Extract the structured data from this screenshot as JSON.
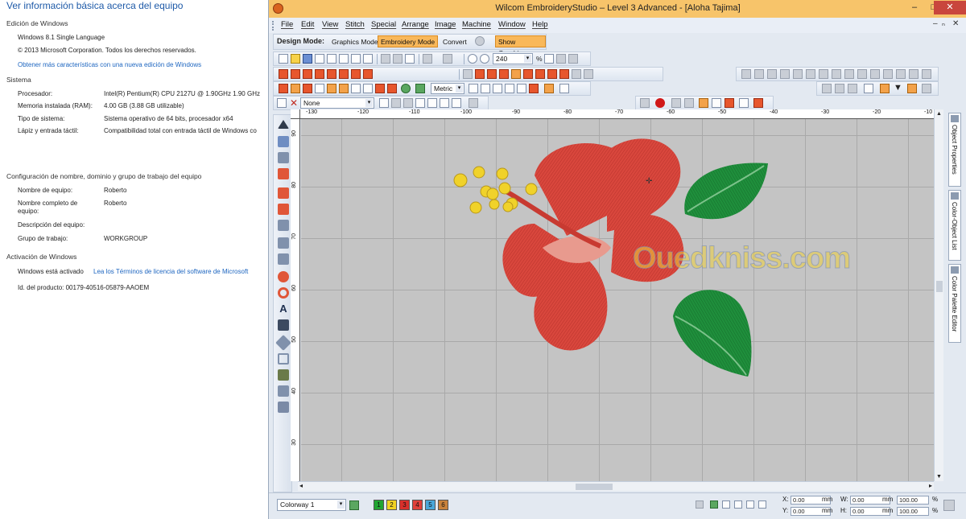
{
  "system_info": {
    "title": "Ver información básica acerca del equipo",
    "edition_section": "Edición de Windows",
    "edition_name": "Windows 8.1 Single Language",
    "copyright": "© 2013 Microsoft Corporation. Todos los derechos reservados.",
    "more_features_link": "Obtener más características con una nueva edición de Windows",
    "system_section": "Sistema",
    "processor_label": "Procesador:",
    "processor_value": "Intel(R) Pentium(R) CPU 2127U @ 1.90GHz   1.90 GHz",
    "memory_label": "Memoria instalada (RAM):",
    "memory_value": "4.00 GB (3.88 GB utilizable)",
    "system_type_label": "Tipo de sistema:",
    "system_type_value": "Sistema operativo de 64 bits, procesador x64",
    "pen_label": "Lápiz y entrada táctil:",
    "pen_value": "Compatibilidad total con entrada táctil de Windows co",
    "computer_section": "Configuración de nombre, dominio y grupo de trabajo del equipo",
    "computer_name_label": "Nombre de equipo:",
    "computer_name_value": "Roberto",
    "full_name_label": "Nombre completo de equipo:",
    "full_name_value": "Roberto",
    "description_label": "Descripción del equipo:",
    "workgroup_label": "Grupo de trabajo:",
    "workgroup_value": "WORKGROUP",
    "activation_section": "Activación de Windows",
    "activation_status": "Windows está activado",
    "license_link": "Lea los Términos de licencia del software de Microsoft",
    "product_id": "Id. del producto: 00179-40516-05879-AAOEM"
  },
  "app": {
    "title": "Wilcom EmbroideryStudio – Level 3 Advanced - [Aloha        Tajima]",
    "window_controls": {
      "minimize": "–",
      "restore": "□",
      "close": "✕"
    },
    "mdi_controls": {
      "minimize": "–",
      "restore": "ₙ",
      "close": "✕"
    },
    "menu": [
      "File",
      "Edit",
      "View",
      "Stitch",
      "Special",
      "Arrange",
      "Image",
      "Machine",
      "Window",
      "Help"
    ],
    "design_mode_label": "Design Mode:",
    "mode_buttons": [
      "Graphics Mode",
      "Embroidery Mode",
      "Convert"
    ],
    "active_mode": "Embroidery Mode",
    "show_graphics": "Show Graphics",
    "zoom_value": "240",
    "zoom_unit": "%",
    "units_value": "Metric",
    "line_none": "None",
    "ruler_h_labels": [
      "-130",
      "-120",
      "-110",
      "-100",
      "-90",
      "-80",
      "-70",
      "-60",
      "-50",
      "-40",
      "-30",
      "-20",
      "-10"
    ],
    "ruler_v_labels": [
      "90",
      "80",
      "70",
      "60",
      "50",
      "40",
      "30"
    ],
    "docker_tabs": [
      "Object Properties",
      "Color-Object List",
      "Color Palette Editor"
    ],
    "watermark": "Ouedkniss.com",
    "statusbar": {
      "colorway": "Colorway 1",
      "swatches": [
        {
          "label": "1",
          "color": "#22a532"
        },
        {
          "label": "2",
          "color": "#f1d323"
        },
        {
          "label": "3",
          "color": "#d9302b"
        },
        {
          "label": "4",
          "color": "#e0403a"
        },
        {
          "label": "5",
          "color": "#49a7d9"
        },
        {
          "label": "6",
          "color": "#c9823b"
        }
      ],
      "x_label": "X:",
      "x_value": "0.00",
      "x_unit": "mm",
      "y_label": "Y:",
      "y_value": "0.00",
      "y_unit": "mm",
      "w_label": "W:",
      "w_value": "0.00",
      "w_unit": "mm",
      "h_label": "H:",
      "h_value": "0.00",
      "h_unit": "mm",
      "wp_value": "100.00",
      "wp_unit": "%",
      "hp_value": "100.00",
      "hp_unit": "%"
    }
  },
  "colors": {
    "titlebar": "#f7c46a",
    "flower": "#d9473d",
    "leaf": "#1f8f3c",
    "stamen": "#f0d22a",
    "canvas": "#c4c4c4"
  }
}
